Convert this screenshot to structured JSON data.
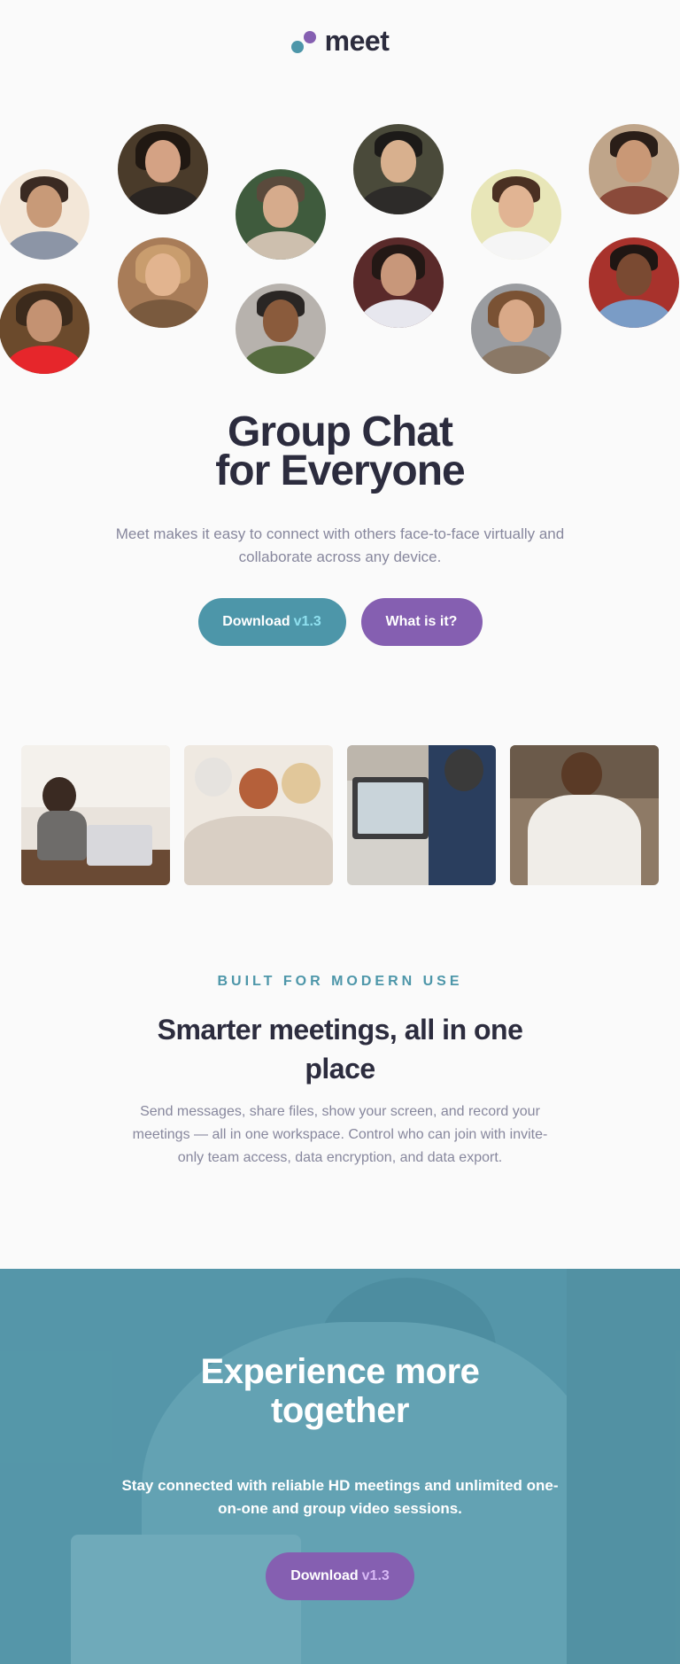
{
  "brand": {
    "logo_text": "meet",
    "teal": "#4d96a9",
    "purple": "#855fb1",
    "dark": "#2c2c3e",
    "gray": "#87879d"
  },
  "hero": {
    "title_line1": "Group Chat",
    "title_line2": "for Everyone",
    "description": "Meet makes it easy to connect with others face-to-face virtually and collaborate across any device.",
    "download_label": "Download",
    "download_version": "v1.3",
    "what_label": "What is it?"
  },
  "features": {
    "eyebrow": "BUILT FOR MODERN USE",
    "title": "Smarter meetings, all in one place",
    "description": "Send messages, share files, show your screen, and record your meetings — all in one workspace. Control who can join with invite-only team access, data encryption, and data export."
  },
  "cta": {
    "title_line1": "Experience more",
    "title_line2": "together",
    "description": "Stay connected with reliable HD meetings and unlimited one-on-one and group video sessions.",
    "download_label": "Download",
    "download_version": "v1.3"
  }
}
